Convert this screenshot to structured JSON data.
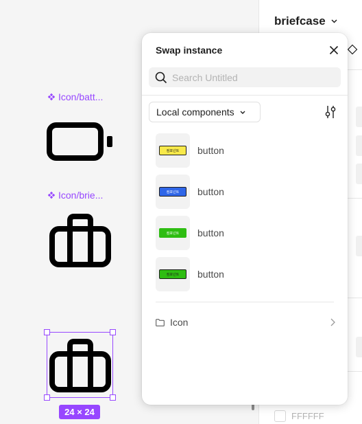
{
  "canvas": {
    "components": [
      {
        "label": "Icon/batt...",
        "icon": "battery-icon"
      },
      {
        "label": "Icon/brie...",
        "icon": "briefcase-icon"
      }
    ],
    "selected_icon": "briefcase-icon",
    "selection_size": "24 × 24",
    "accent_color": "#9747ff"
  },
  "right_panel": {
    "title": "briefcase",
    "title_icon": "chevron-down-icon",
    "color_hex": "FFFFFF"
  },
  "swap_instance": {
    "title": "Swap instance",
    "close_icon": "close-icon",
    "search_placeholder": "Search Untitled",
    "search_value": "",
    "source_select": "Local components",
    "filter_icon": "sliders-icon",
    "components": [
      {
        "label": "button",
        "preview_text": "컴포넌트",
        "preview_color": "#f8e94a",
        "preview_text_color": "#1e1e1e"
      },
      {
        "label": "button",
        "preview_text": "컴포넌트",
        "preview_color": "#2f66e8",
        "preview_text_color": "#ffffff"
      },
      {
        "label": "button",
        "preview_text": "컴포넌트",
        "preview_color": "#2ebd12",
        "preview_text_color": "#ffffff"
      },
      {
        "label": "button",
        "preview_text": "컴포넌트",
        "preview_color": "#2ebd12",
        "preview_text_color": "#1e1e1e"
      }
    ],
    "folder": {
      "label": "Icon",
      "icon": "folder-icon",
      "trailing_icon": "chevron-right-icon"
    }
  }
}
